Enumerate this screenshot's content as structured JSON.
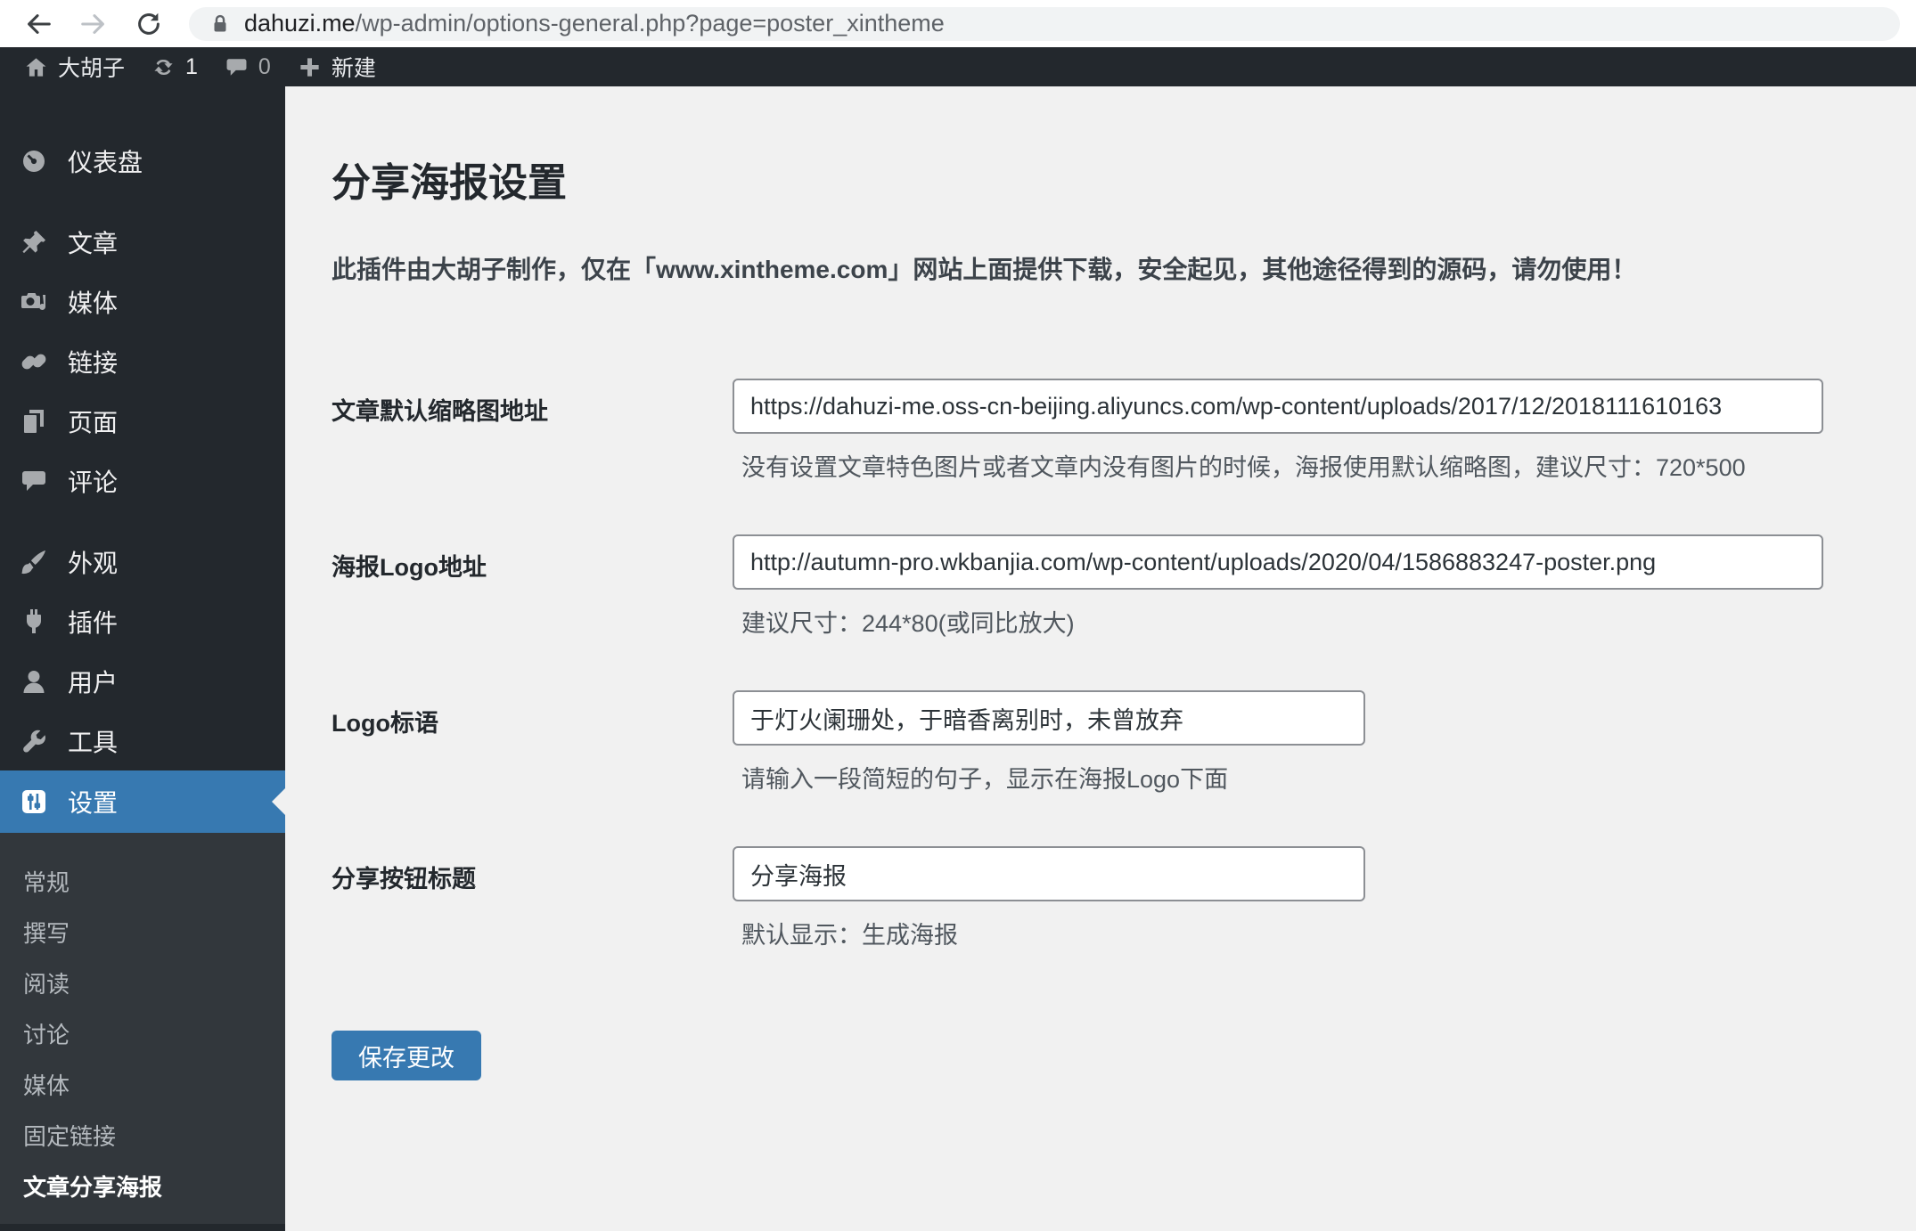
{
  "colors": {
    "accent": "#3779b1",
    "sidebar_bg": "#23282d",
    "submenu_bg": "#32373c",
    "content_bg": "#f1f1f1"
  },
  "browser": {
    "url_domain": "dahuzi.me",
    "url_path": "/wp-admin/options-general.php?page=poster_xintheme"
  },
  "admin_bar": {
    "site_name": "大胡子",
    "update_count": "1",
    "comment_count": "0",
    "new_label": "新建"
  },
  "sidebar": {
    "items": [
      {
        "label": "仪表盘"
      },
      {
        "label": "文章"
      },
      {
        "label": "媒体"
      },
      {
        "label": "链接"
      },
      {
        "label": "页面"
      },
      {
        "label": "评论"
      },
      {
        "label": "外观"
      },
      {
        "label": "插件"
      },
      {
        "label": "用户"
      },
      {
        "label": "工具"
      },
      {
        "label": "设置"
      }
    ],
    "submenu": [
      {
        "label": "常规"
      },
      {
        "label": "撰写"
      },
      {
        "label": "阅读"
      },
      {
        "label": "讨论"
      },
      {
        "label": "媒体"
      },
      {
        "label": "固定链接"
      },
      {
        "label": "文章分享海报"
      }
    ]
  },
  "main": {
    "title": "分享海报设置",
    "notice": "此插件由大胡子制作，仅在「www.xintheme.com」网站上面提供下载，安全起见，其他途径得到的源码，请勿使用！",
    "fields": [
      {
        "label": "文章默认缩略图地址",
        "value": "https://dahuzi-me.oss-cn-beijing.aliyuncs.com/wp-content/uploads/2017/12/2018111610163",
        "help": "没有设置文章特色图片或者文章内没有图片的时候，海报使用默认缩略图，建议尺寸：720*500"
      },
      {
        "label": "海报Logo地址",
        "value": "http://autumn-pro.wkbanjia.com/wp-content/uploads/2020/04/1586883247-poster.png",
        "help": "建议尺寸：244*80(或同比放大)"
      },
      {
        "label": "Logo标语",
        "value": "于灯火阑珊处，于暗香离别时，未曾放弃",
        "help": "请输入一段简短的句子，显示在海报Logo下面"
      },
      {
        "label": "分享按钮标题",
        "value": "分享海报",
        "help": "默认显示：生成海报"
      }
    ],
    "save_label": "保存更改"
  }
}
